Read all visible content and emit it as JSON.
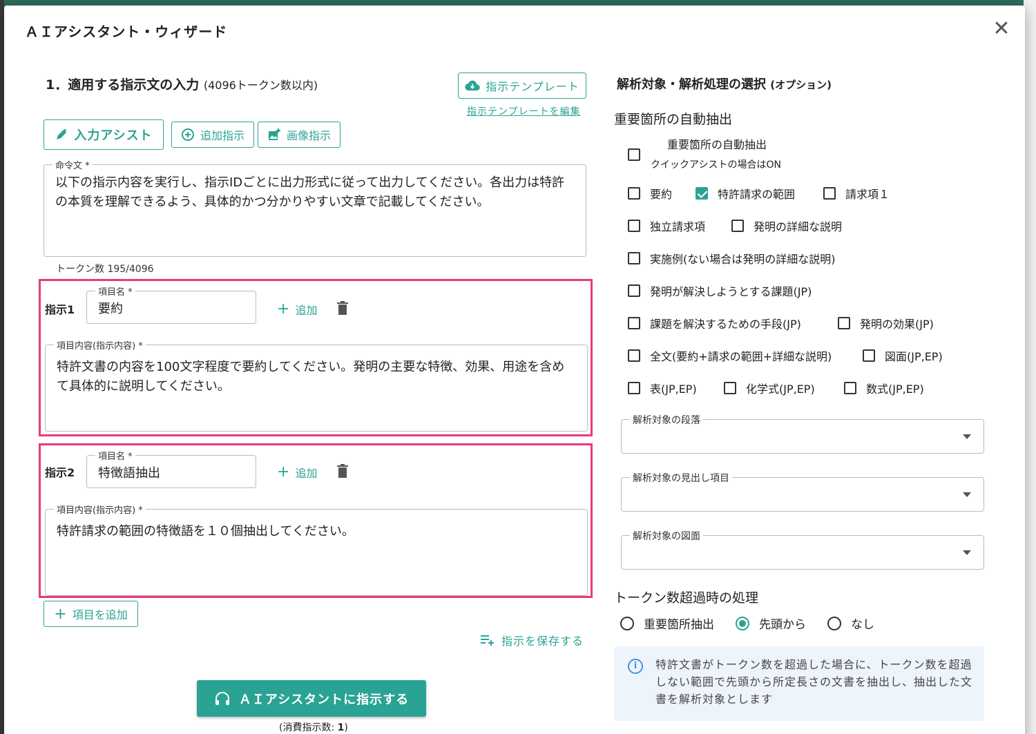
{
  "dialog": {
    "title": "ＡＩアシスタント・ウィザード",
    "close_glyph": "✕"
  },
  "left": {
    "section_title": "1．適用する指示文の入力",
    "section_subtitle": "(4096トークン数以内)",
    "template_button": "指示テンプレート",
    "template_edit_link": "指示テンプレートを編集",
    "assist_button": "入力アシスト",
    "add_instruction_button": "追加指示",
    "image_instruction_button": "画像指示",
    "command_label": "命令文 *",
    "command_text": "以下の指示内容を実行し、指示IDごとに出力形式に従って出力してください。各出力は特許の本質を理解できるよう、具体的かつ分かりやすい文章で記載してください。",
    "token_count": "トークン数 195/4096",
    "instructions": [
      {
        "label": "指示1",
        "name_label": "項目名 *",
        "name_value": "要約",
        "add_label": "追加",
        "content_label": "項目内容(指示内容) *",
        "content_value": "特許文書の内容を100文字程度で要約してください。発明の主要な特徴、効果、用途を含めて具体的に説明してください。"
      },
      {
        "label": "指示2",
        "name_label": "項目名 *",
        "name_value": "特徴語抽出",
        "add_label": "追加",
        "content_label": "項目内容(指示内容) *",
        "content_value": "特許請求の範囲の特徴語を１０個抽出してください。"
      }
    ],
    "add_item_button": "項目を追加",
    "save_link": "指示を保存する",
    "submit_button": "ＡＩアシスタントに指示する",
    "consume_prefix": "(消費指示数: ",
    "consume_count": "1",
    "consume_suffix": ")"
  },
  "right": {
    "section_title": "解析対象・解析処理の選択",
    "section_subtitle": "(オプション)",
    "auto_extract_heading": "重要箇所の自動抽出",
    "auto_extract_checkbox_label": "重要箇所の自動抽出",
    "auto_extract_note": "クイックアシストの場合はON",
    "auto_extract_checked": false,
    "checkboxes": {
      "summary": {
        "label": "要約",
        "checked": false
      },
      "claims_scope": {
        "label": "特許請求の範囲",
        "checked": true
      },
      "claim1": {
        "label": "請求項１",
        "checked": false
      },
      "independent_claims": {
        "label": "独立請求項",
        "checked": false
      },
      "detailed_description": {
        "label": "発明の詳細な説明",
        "checked": false
      },
      "embodiments": {
        "label": "実施例(ない場合は発明の詳細な説明)",
        "checked": false
      },
      "problem": {
        "label": "発明が解決しようとする課題(JP)",
        "checked": false
      },
      "means": {
        "label": "課題を解決するための手段(JP)",
        "checked": false
      },
      "effect": {
        "label": "発明の効果(JP)",
        "checked": false
      },
      "full_text": {
        "label": "全文(要約+請求の範囲+詳細な説明)",
        "checked": false
      },
      "figures": {
        "label": "図面(JP,EP)",
        "checked": false
      },
      "tables": {
        "label": "表(JP,EP)",
        "checked": false
      },
      "chem": {
        "label": "化学式(JP,EP)",
        "checked": false
      },
      "math": {
        "label": "数式(JP,EP)",
        "checked": false
      }
    },
    "selects": {
      "paragraph_label": "解析対象の段落",
      "heading_label": "解析対象の見出し項目",
      "figure_label": "解析対象の図面"
    },
    "overflow_heading": "トークン数超過時の処理",
    "radios": [
      {
        "label": "重要箇所抽出",
        "selected": false
      },
      {
        "label": "先頭から",
        "selected": true
      },
      {
        "label": "なし",
        "selected": false
      }
    ],
    "info_text": "特許文書がトークン数を超過した場合に、トークン数を超過しない範囲で先頭から所定長さの文書を抽出し、抽出した文書を解析対象とします"
  },
  "colors": {
    "accent": "#2aa394",
    "highlight": "#e8397d",
    "info_bg": "#eef4fb"
  }
}
